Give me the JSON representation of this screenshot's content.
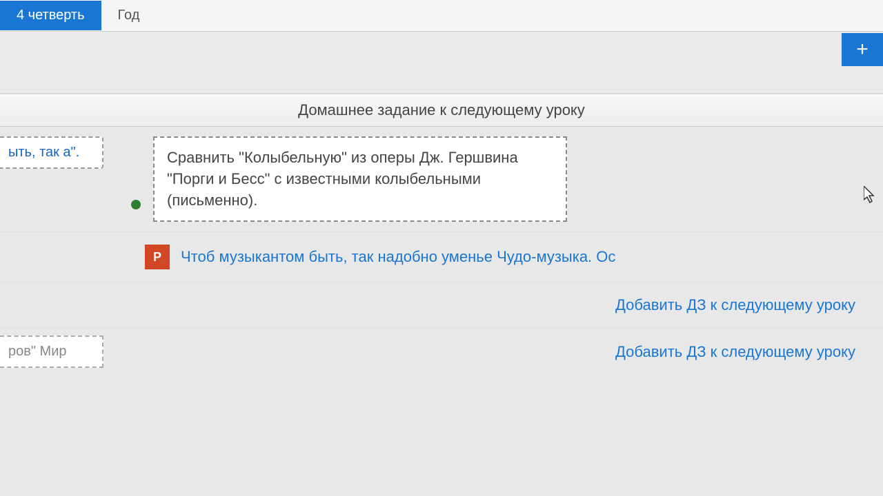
{
  "tabs": {
    "active": "4 четверть",
    "other": "Год"
  },
  "add_button": "+",
  "section_title": "Домашнее задание к следующему уроку",
  "row1": {
    "left_text": "ыть, так а\".",
    "homework_text": "Сравнить \"Колыбельную\" из оперы Дж. Гершвина \"Порги и Бесс\" с известными колыбельными (письменно)."
  },
  "attachment": {
    "icon_label": "P",
    "link_text": "Чтоб музыкантом быть, так надобно уменье Чудо-музыка. Ос"
  },
  "action1": "Добавить ДЗ к следующему уроку",
  "row2": {
    "left_text": "ров\" Мир"
  },
  "action2": "Добавить ДЗ к следующему уроку"
}
